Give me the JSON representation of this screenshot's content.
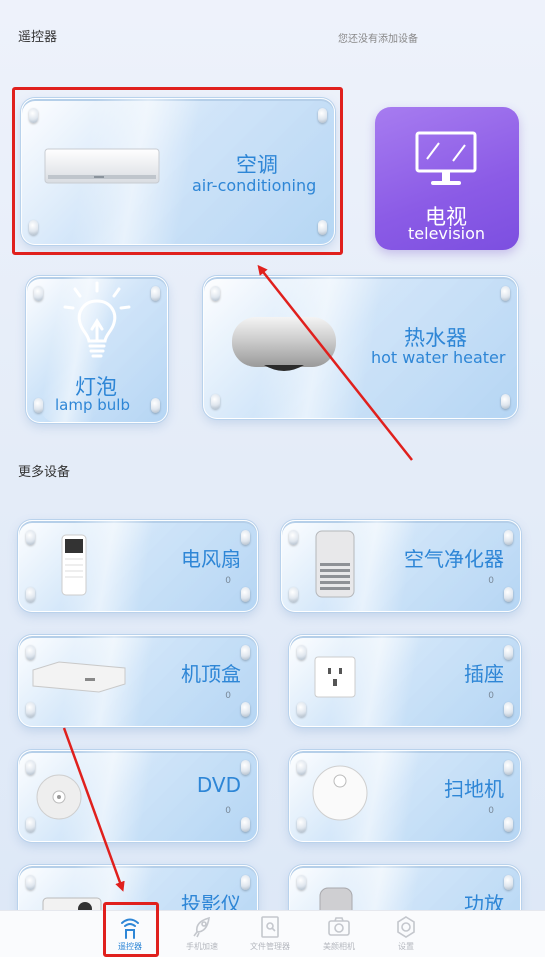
{
  "header": {
    "title": "遥控器",
    "hint": "您还没有添加设备"
  },
  "featured": [
    {
      "cn": "空调",
      "en": "air-conditioning",
      "icon": "air-conditioner-icon"
    },
    {
      "cn": "电视",
      "en": "television",
      "icon": "monitor-icon"
    },
    {
      "cn": "灯泡",
      "en": "lamp bulb",
      "icon": "light-bulb-icon"
    },
    {
      "cn": "热水器",
      "en": "hot water heater",
      "icon": "water-heater-icon"
    }
  ],
  "more_section_title": "更多设备",
  "more_devices": [
    {
      "name": "电风扇",
      "count": "0",
      "icon": "tower-fan-icon"
    },
    {
      "name": "空气净化器",
      "count": "0",
      "icon": "air-purifier-icon"
    },
    {
      "name": "机顶盒",
      "count": "0",
      "icon": "set-top-box-icon"
    },
    {
      "name": "插座",
      "count": "0",
      "icon": "wall-socket-icon"
    },
    {
      "name": "DVD",
      "count": "0",
      "icon": "dvd-disc-icon"
    },
    {
      "name": "扫地机",
      "count": "0",
      "icon": "robot-vacuum-icon"
    },
    {
      "name": "投影仪",
      "count": "",
      "icon": "projector-icon"
    },
    {
      "name": "功放",
      "count": "",
      "icon": "amplifier-icon"
    }
  ],
  "tabbar": [
    {
      "label": "遥控器",
      "icon": "wifi-remote-icon",
      "active": true
    },
    {
      "label": "手机加速",
      "icon": "rocket-icon",
      "active": false
    },
    {
      "label": "文件管理器",
      "icon": "file-search-icon",
      "active": false
    },
    {
      "label": "美颜相机",
      "icon": "camera-icon",
      "active": false
    },
    {
      "label": "设置",
      "icon": "gear-icon",
      "active": false
    }
  ],
  "colors": {
    "accent": "#2e86d6",
    "highlight": "#e0201d",
    "tv_card": "#8b5be6"
  }
}
